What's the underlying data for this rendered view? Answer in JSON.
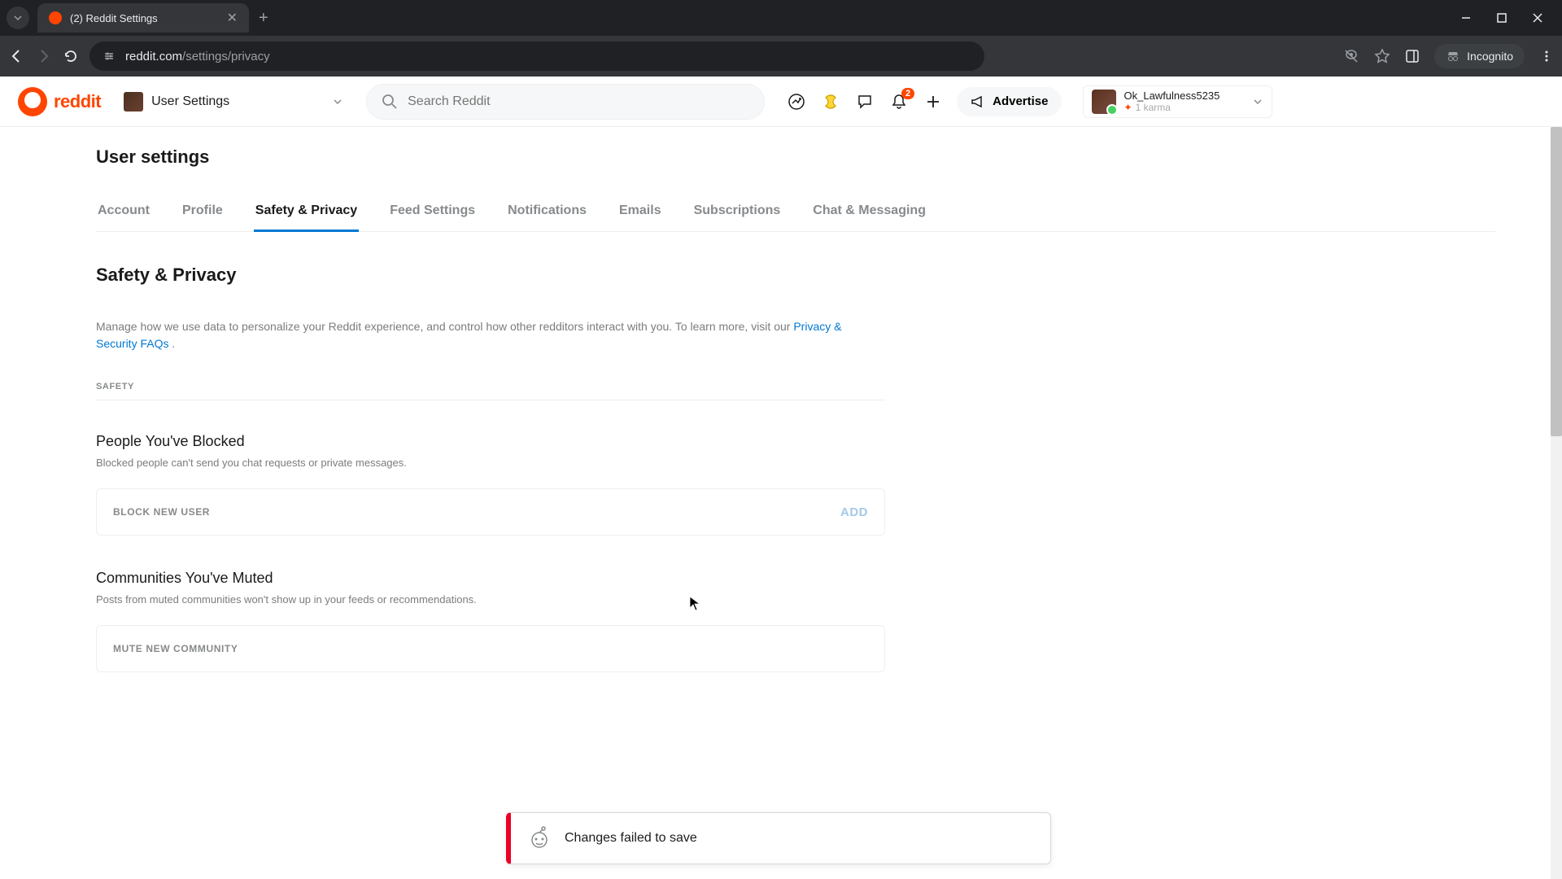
{
  "browser": {
    "tab_title": "(2) Reddit Settings",
    "url_domain": "reddit.com",
    "url_path": "/settings/privacy",
    "incognito_label": "Incognito"
  },
  "header": {
    "logo_text": "reddit",
    "context_label": "User Settings",
    "search_placeholder": "Search Reddit",
    "advertise_label": "Advertise",
    "notification_count": "2",
    "user": {
      "name": "Ok_Lawfulness5235",
      "karma": "1 karma"
    }
  },
  "page": {
    "title": "User settings",
    "tabs": [
      "Account",
      "Profile",
      "Safety & Privacy",
      "Feed Settings",
      "Notifications",
      "Emails",
      "Subscriptions",
      "Chat & Messaging"
    ],
    "active_tab_index": 2,
    "section_title": "Safety & Privacy",
    "section_desc_1": "Manage how we use data to personalize your Reddit experience, and control how other redditors interact with you. To learn more, visit our ",
    "section_desc_link": "Privacy & Security FAQs ",
    "section_desc_2": ".",
    "safety_label": "SAFETY",
    "blocked": {
      "title": "People You've Blocked",
      "desc": "Blocked people can't send you chat requests or private messages.",
      "placeholder": "BLOCK NEW USER",
      "add_label": "ADD"
    },
    "muted": {
      "title": "Communities You've Muted",
      "desc": "Posts from muted communities won't show up in your feeds or recommendations.",
      "placeholder": "MUTE NEW COMMUNITY"
    }
  },
  "toast": {
    "message": "Changes failed to save"
  }
}
